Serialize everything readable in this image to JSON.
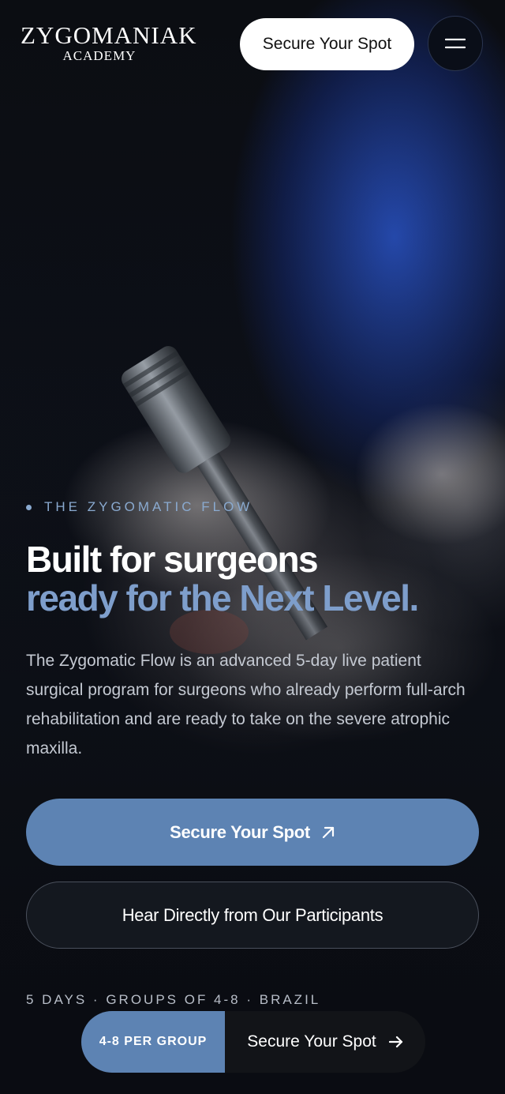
{
  "header": {
    "logo_main": "ZYGOMANIAK",
    "logo_sub": "ACADEMY",
    "cta_label": "Secure Your Spot",
    "menu_icon": "hamburger-icon"
  },
  "hero": {
    "eyebrow": "THE ZYGOMATIC FLOW",
    "headline_line1": "Built for surgeons",
    "headline_line2": "ready for the Next Level.",
    "description": "The Zygomatic Flow is an advanced 5-day live patient surgical program for surgeons who already perform full-arch rehabilitation and are ready to take on the severe atrophic maxilla.",
    "primary_cta": "Secure Your Spot",
    "primary_cta_icon": "arrow-up-right-icon",
    "secondary_cta": "Hear Directly from Our Participants",
    "meta": "5 DAYS · GROUPS OF 4-8 · BRAZIL"
  },
  "sticky_bar": {
    "badge": "4-8 PER GROUP",
    "cta_label": "Secure Your Spot",
    "cta_icon": "arrow-right-icon"
  },
  "colors": {
    "accent": "#5d83b3",
    "accent_text": "#7e9ecb",
    "background": "#0b0e14"
  }
}
